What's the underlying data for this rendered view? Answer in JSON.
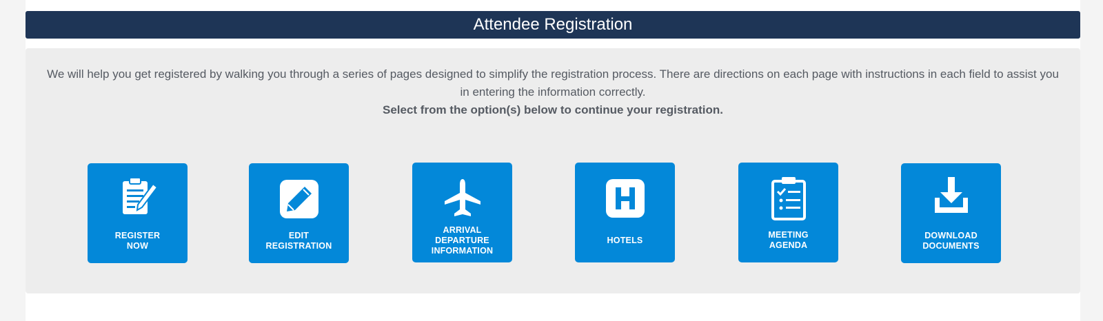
{
  "header": {
    "title": "Attendee Registration"
  },
  "intro": {
    "paragraph": "We will help you get registered by walking you through a series of pages designed to simplify the registration process. There are directions on each page with instructions in each field to assist you in entering the information correctly.",
    "instruction": "Select from the option(s) below to continue your registration."
  },
  "options": [
    {
      "label": "REGISTER\nNOW",
      "icon": "clipboard-pen-icon"
    },
    {
      "label": "EDIT\nREGISTRATION",
      "icon": "pencil-square-icon"
    },
    {
      "label": "ARRIVAL\nDEPARTURE\nINFORMATION",
      "icon": "airplane-icon"
    },
    {
      "label": "HOTELS",
      "icon": "hotel-h-icon"
    },
    {
      "label": "MEETING\nAGENDA",
      "icon": "checklist-clipboard-icon"
    },
    {
      "label": "DOWNLOAD\nDOCUMENTS",
      "icon": "download-icon"
    }
  ],
  "colors": {
    "header_bg": "#1e3556",
    "panel_bg": "#ededed",
    "tile_bg": "#0388d9",
    "text": "#555a62"
  }
}
